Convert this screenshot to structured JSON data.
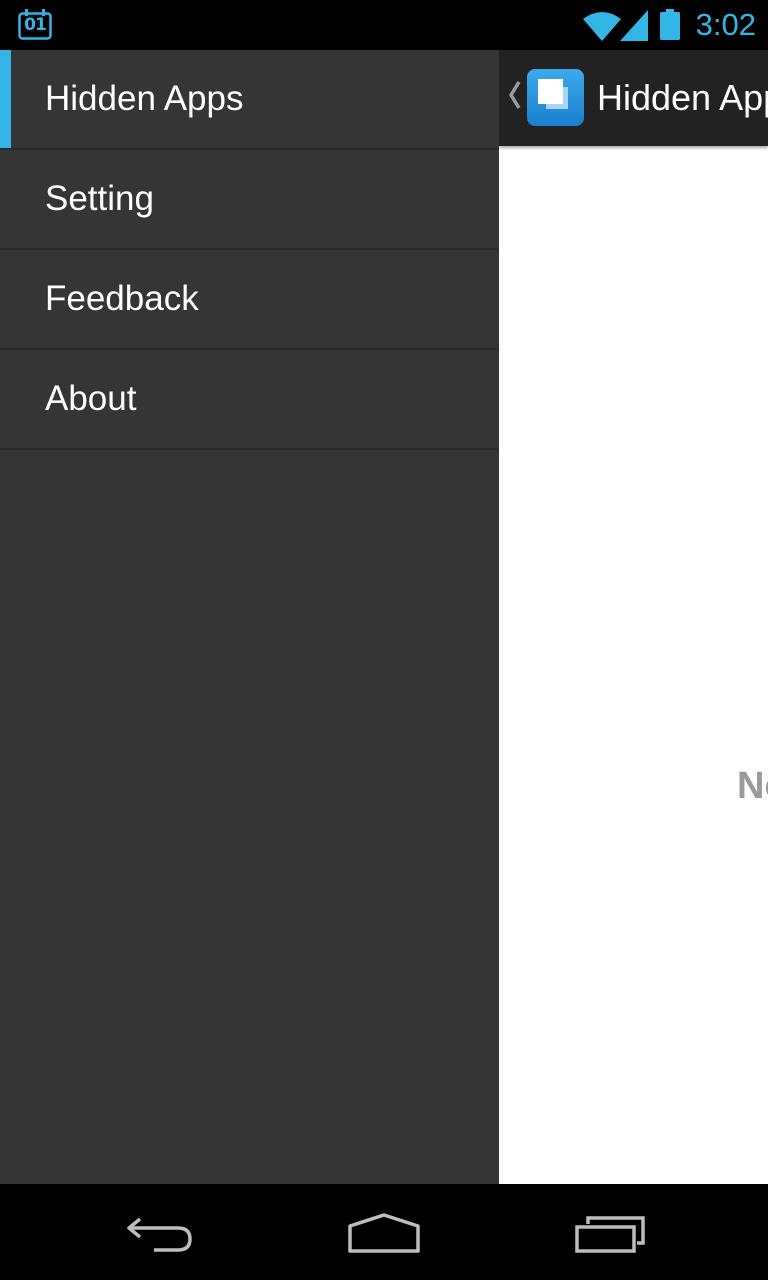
{
  "status_bar": {
    "calendar_day": "01",
    "time": "3:02",
    "icons": [
      "calendar-icon",
      "wifi-icon",
      "signal-icon",
      "battery-icon"
    ],
    "accent_color": "#33b5e5"
  },
  "drawer": {
    "items": [
      {
        "label": "Hidden Apps",
        "active": true
      },
      {
        "label": "Setting",
        "active": false
      },
      {
        "label": "Feedback",
        "active": false
      },
      {
        "label": "About",
        "active": false
      }
    ],
    "background": "#353535",
    "active_indicator_color": "#33b5e5"
  },
  "action_bar": {
    "title": "Hidden Apps",
    "icons": [
      "up-caret-icon",
      "app-icon"
    ]
  },
  "main": {
    "empty_text": "No"
  },
  "nav_bar": {
    "icons": [
      "back-icon",
      "home-icon",
      "recent-apps-icon"
    ]
  }
}
